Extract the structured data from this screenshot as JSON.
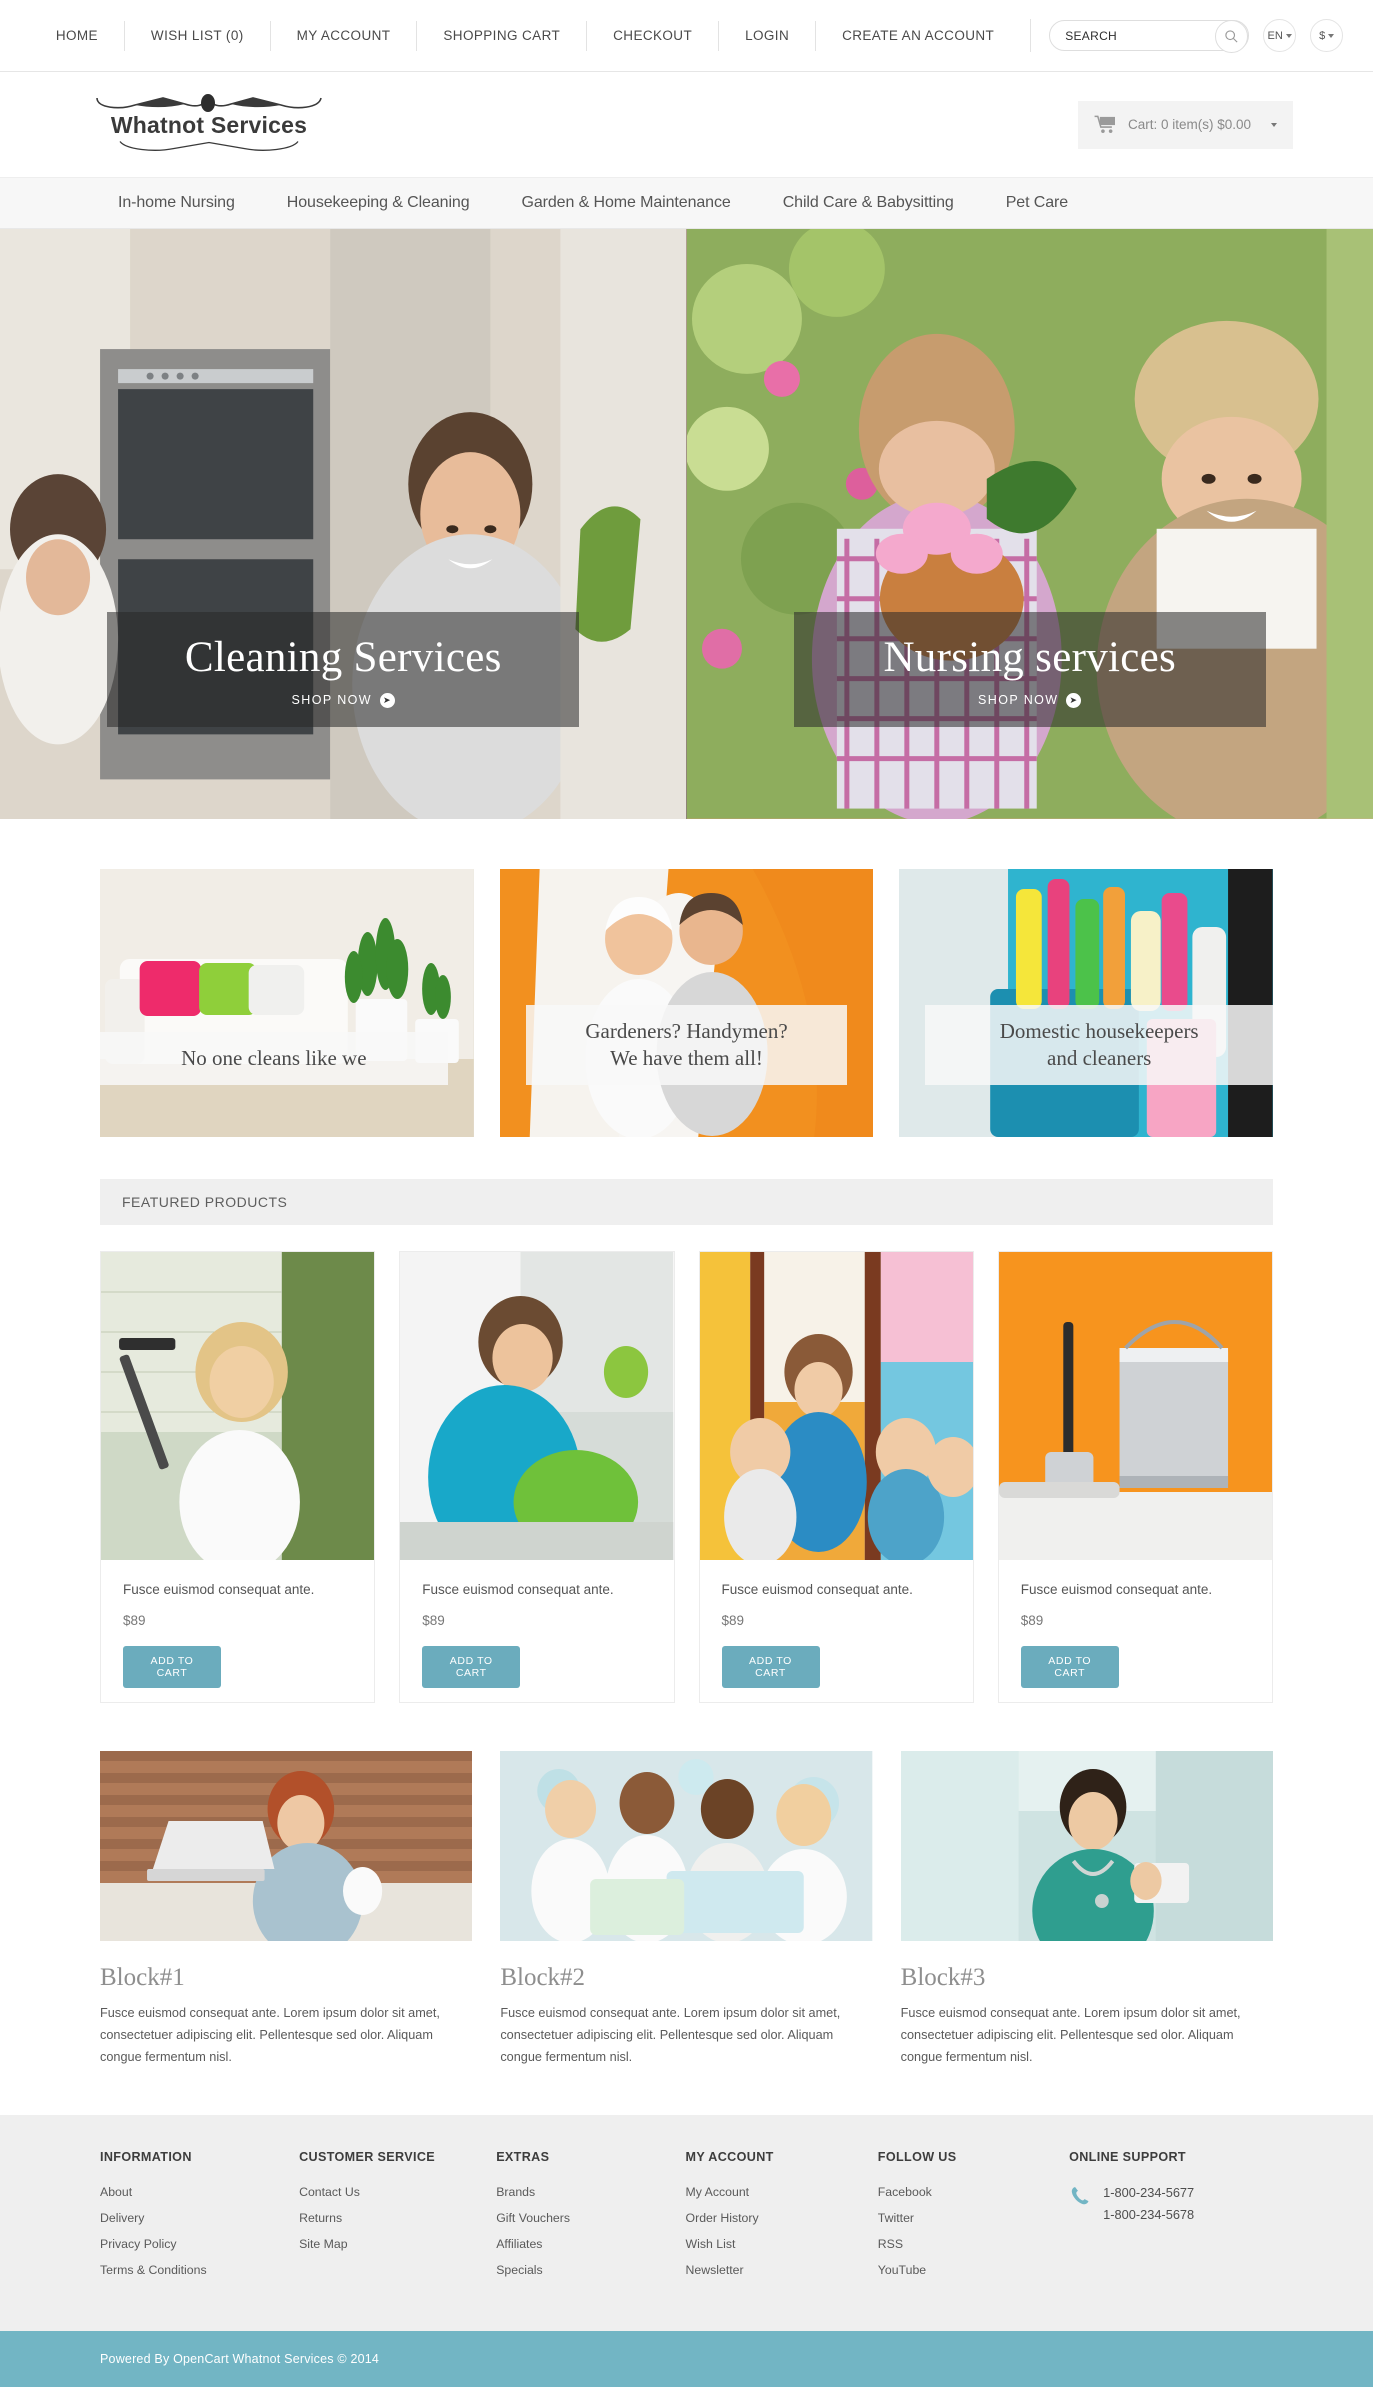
{
  "topbar": {
    "links": [
      {
        "label": "HOME"
      },
      {
        "label": "WISH LIST (0)"
      },
      {
        "label": "MY ACCOUNT"
      },
      {
        "label": "SHOPPING CART"
      },
      {
        "label": "CHECKOUT"
      },
      {
        "label": "LOGIN"
      },
      {
        "label": "CREATE AN ACCOUNT"
      }
    ],
    "search": {
      "value": "",
      "placeholder": "SEARCH"
    },
    "language": "EN",
    "currency": "$"
  },
  "header": {
    "logo_text": "Whatnot Services",
    "cart_label": "Cart: 0 item(s) $0.00"
  },
  "catnav": {
    "items": [
      {
        "label": "In-home Nursing"
      },
      {
        "label": "Housekeeping & Cleaning"
      },
      {
        "label": "Garden & Home Maintenance"
      },
      {
        "label": "Child Care & Babysitting"
      },
      {
        "label": "Pet Care"
      }
    ]
  },
  "hero": {
    "slides": [
      {
        "title": "Cleaning Services",
        "cta": "SHOP NOW"
      },
      {
        "title": "Nursing services",
        "cta": "SHOP NOW"
      }
    ]
  },
  "promos": [
    {
      "text": "No one cleans like we"
    },
    {
      "text": "Gardeners? Handymen?\nWe have them all!"
    },
    {
      "text": "Domestic housekeepers\nand cleaners"
    }
  ],
  "featured": {
    "heading": "FEATURED PRODUCTS",
    "products": [
      {
        "name": "Fusce euismod consequat ante.",
        "price": "$89",
        "button": "ADD TO  CART"
      },
      {
        "name": "Fusce euismod consequat ante.",
        "price": "$89",
        "button": "ADD TO  CART"
      },
      {
        "name": "Fusce euismod consequat ante.",
        "price": "$89",
        "button": "ADD TO  CART"
      },
      {
        "name": "Fusce euismod consequat ante.",
        "price": "$89",
        "button": "ADD TO  CART"
      }
    ]
  },
  "blocks": [
    {
      "title": "Block#1",
      "body": "Fusce euismod consequat ante. Lorem ipsum dolor sit amet, consectetuer adipiscing elit. Pellentesque sed olor. Aliquam congue fermentum nisl."
    },
    {
      "title": "Block#2",
      "body": "Fusce euismod consequat ante. Lorem ipsum dolor sit amet, consectetuer adipiscing elit. Pellentesque sed olor. Aliquam congue fermentum nisl."
    },
    {
      "title": "Block#3",
      "body": "Fusce euismod consequat ante. Lorem ipsum dolor sit amet, consectetuer adipiscing elit. Pellentesque sed olor. Aliquam congue fermentum nisl."
    }
  ],
  "footer": {
    "columns": [
      {
        "title": "INFORMATION",
        "links": [
          "About",
          "Delivery",
          "Privacy Policy",
          "Terms & Conditions"
        ]
      },
      {
        "title": "CUSTOMER SERVICE",
        "links": [
          "Contact Us",
          "Returns",
          "Site Map"
        ]
      },
      {
        "title": "EXTRAS",
        "links": [
          "Brands",
          "Gift Vouchers",
          "Affiliates",
          "Specials"
        ]
      },
      {
        "title": "MY ACCOUNT",
        "links": [
          "My Account",
          "Order History",
          "Wish List",
          "Newsletter"
        ]
      },
      {
        "title": "FOLLOW US",
        "links": [
          "Facebook",
          "Twitter",
          "RSS",
          "YouTube"
        ]
      }
    ],
    "support": {
      "title": "ONLINE SUPPORT",
      "phones": [
        "1-800-234-5677",
        "1-800-234-5678"
      ]
    },
    "copyright": "Powered By OpenCart Whatnot Services © 2014"
  },
  "colors": {
    "accent": "#72b5c4",
    "button": "#6bacbd",
    "footer_bg": "#efefef",
    "nav_bg": "#f7f7f7"
  }
}
